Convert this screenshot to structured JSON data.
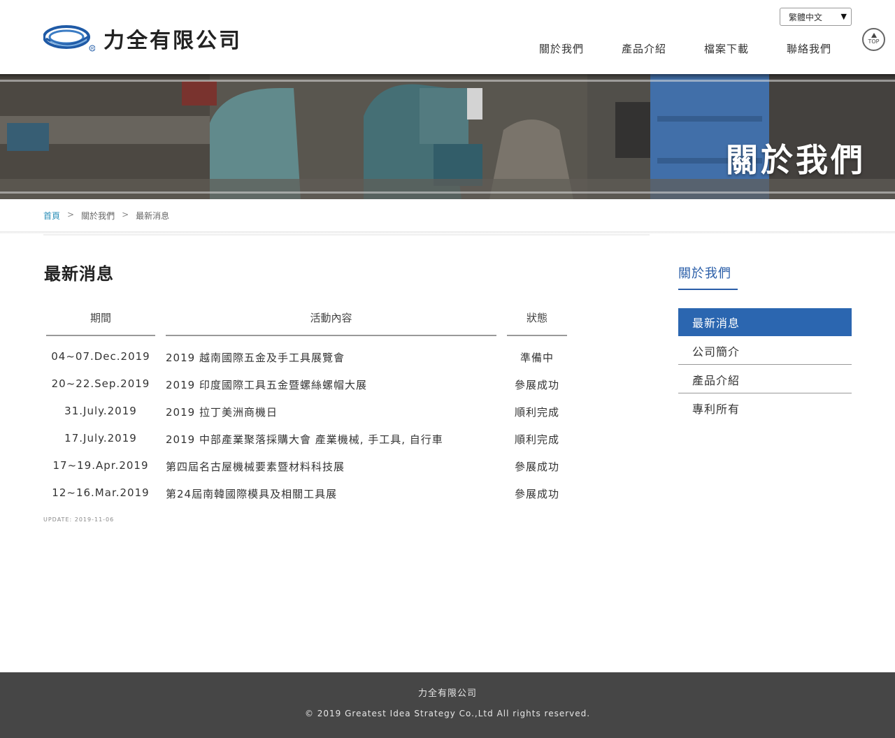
{
  "header": {
    "company_name": "力全有限公司",
    "language": "繁體中文",
    "top_label": "TOP",
    "nav": [
      {
        "label": "關於我們"
      },
      {
        "label": "產品介紹"
      },
      {
        "label": "檔案下載"
      },
      {
        "label": "聯絡我們"
      }
    ]
  },
  "banner": {
    "title": "關於我們"
  },
  "breadcrumb": {
    "home": "首頁",
    "separator": ">",
    "level1": "關於我們",
    "current": "最新消息"
  },
  "main": {
    "title": "最新消息",
    "table": {
      "headers": [
        "期間",
        "活動內容",
        "狀態"
      ],
      "rows": [
        {
          "date": "04~07.Dec.2019",
          "event": "2019 越南國際五金及手工具展覽會",
          "status": "準備中"
        },
        {
          "date": "20~22.Sep.2019",
          "event": "2019 印度國際工具五金暨螺絲螺帽大展",
          "status": "參展成功"
        },
        {
          "date": "31.July.2019",
          "event": "2019 拉丁美洲商機日",
          "status": "順利完成"
        },
        {
          "date": "17.July.2019",
          "event": "2019 中部產業聚落採購大會 產業機械, 手工具, 自行車",
          "status": "順利完成"
        },
        {
          "date": "17~19.Apr.2019",
          "event": "第四屆名古屋機械要素暨材料科技展",
          "status": "參展成功"
        },
        {
          "date": "12~16.Mar.2019",
          "event": "第24屆南韓國際模具及相關工具展",
          "status": "參展成功"
        }
      ]
    },
    "update": "UPDATE: 2019-11-06"
  },
  "sidebar": {
    "title": "關於我們",
    "items": [
      {
        "label": "最新消息",
        "active": true
      },
      {
        "label": "公司簡介",
        "active": false
      },
      {
        "label": "產品介紹",
        "active": false
      },
      {
        "label": "專利所有",
        "active": false
      }
    ]
  },
  "footer": {
    "company": "力全有限公司",
    "copyright": "© 2019 Greatest Idea Strategy Co.,Ltd All rights reserved."
  },
  "colors": {
    "accent_blue": "#2b66b0",
    "sidebar_title": "#2a5ea8",
    "breadcrumb_home": "#2c8fb8",
    "footer_bg": "#464646"
  },
  "icons": {
    "logo": "company-logo-swirl-icon",
    "top": "top-arrow-icon",
    "select": "dropdown-arrow-icon"
  }
}
